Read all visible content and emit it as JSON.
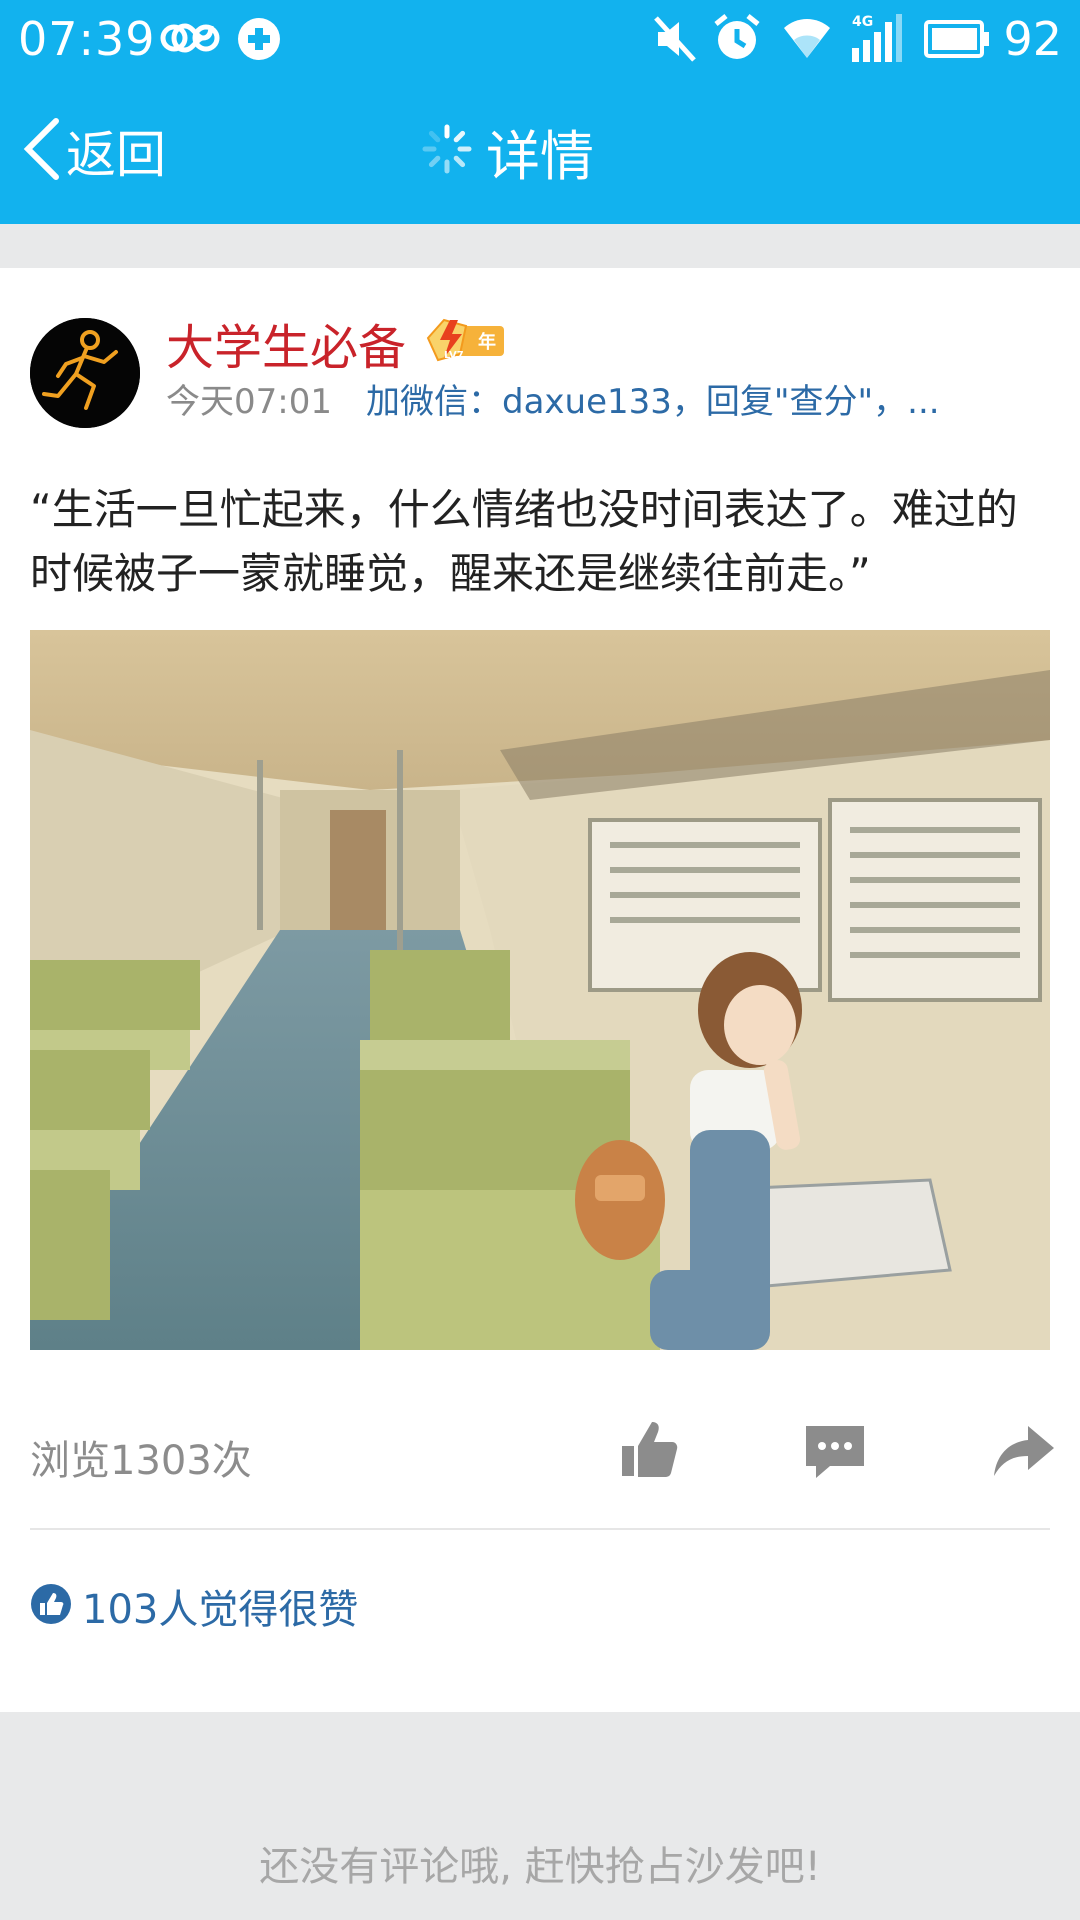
{
  "status_bar": {
    "time": "07:39",
    "battery": "92",
    "icons": [
      "infinity-icon",
      "sync-icon",
      "mute-icon",
      "alarm-icon",
      "wifi-icon",
      "4g-signal-icon",
      "battery-icon"
    ]
  },
  "title_bar": {
    "back_label": "返回",
    "title": "详情",
    "loading": true
  },
  "post": {
    "author": "大学生必备",
    "badge": {
      "level": "LV7",
      "suffix": "年"
    },
    "time": "今天07:01",
    "signature": "加微信：daxue133，回复\"查分\"，...",
    "text": "“生活一旦忙起来，什么情绪也没时间表达了。难过的时候被子一蒙就睡觉，醒来还是继续往前走。”",
    "image_alt": "illustration-girl-in-train-carriage",
    "views": "浏览1303次",
    "likes_text": "103人觉得很赞"
  },
  "comments": {
    "empty_hint": "还没有评论哦, 赶快抢占沙发吧!"
  },
  "colors": {
    "accent": "#12b2ee",
    "author": "#c9232a",
    "link": "#2c6aa6",
    "muted": "#8c8c8c"
  }
}
